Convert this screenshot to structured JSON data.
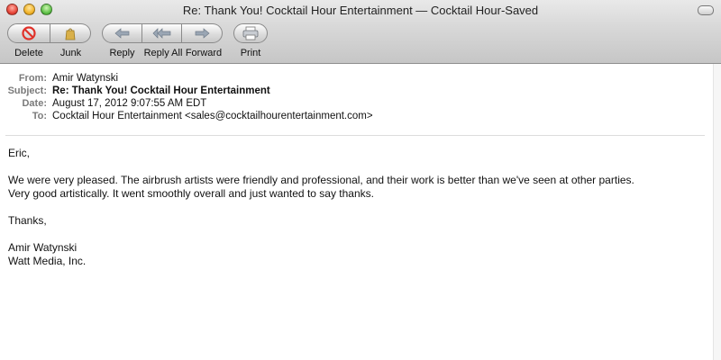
{
  "window": {
    "title": "Re: Thank You! Cocktail Hour Entertainment — Cocktail Hour-Saved"
  },
  "toolbar": {
    "delete_label": "Delete",
    "junk_label": "Junk",
    "reply_label": "Reply",
    "reply_all_label": "Reply All",
    "forward_label": "Forward",
    "print_label": "Print"
  },
  "headers": {
    "from_key": "From:",
    "from_value": "Amir Watynski",
    "subject_key": "Subject:",
    "subject_value": "Re: Thank You! Cocktail Hour Entertainment",
    "date_key": "Date:",
    "date_value": "August 17, 2012 9:07:55 AM EDT",
    "to_key": "To:",
    "to_value": "Cocktail Hour Entertainment <sales@cocktailhourentertainment.com>"
  },
  "message": {
    "greeting": "Eric,",
    "line1": "We were very pleased. The airbrush artists were friendly and professional, and their work is better than we've seen at other parties.",
    "line2": "Very good artistically. It went smoothly overall and just wanted to say thanks.",
    "closing": "Thanks,",
    "sig_name": "Amir Watynski",
    "sig_company": "Watt Media, Inc."
  },
  "colors": {
    "delete_icon": "#e0322a",
    "junk_icon": "#c9a13b",
    "arrow_icon": "#9aa6b4"
  },
  "icons": {
    "delete": "no-entry-icon",
    "junk": "junk-bag-icon",
    "reply": "reply-arrow-icon",
    "reply_all": "reply-all-arrow-icon",
    "forward": "forward-arrow-icon",
    "print": "printer-icon"
  }
}
